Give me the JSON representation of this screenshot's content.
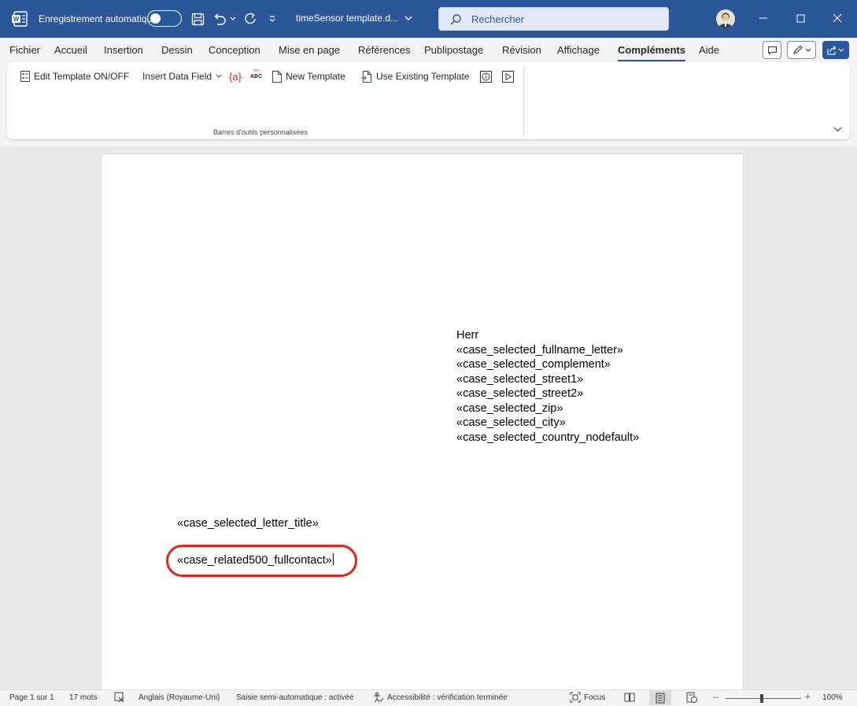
{
  "titlebar": {
    "autosave_label": "Enregistrement automatique",
    "filename": "timeSensor template.d...",
    "search_label": "Rechercher",
    "brand_color": "#2b579a"
  },
  "menu": {
    "items": [
      "Fichier",
      "Accueil",
      "Insertion",
      "Dessin",
      "Conception",
      "Mise en page",
      "Références",
      "Publipostage",
      "Révision",
      "Affichage",
      "Compléments",
      "Aide"
    ],
    "active": "Compléments"
  },
  "ribbon": {
    "edit_template": "Edit Template ON/OFF",
    "insert_data_field": "Insert Data Field",
    "abc_top": "«» ",
    "abc_bottom": "ABC",
    "braces": "{a}",
    "new_template": "New Template",
    "use_existing": "Use Existing Template",
    "group_label": "Barres d'outils personnalisées"
  },
  "document": {
    "address_lines": [
      "Herr",
      "«case_selected_fullname_letter»",
      "«case_selected_complement»",
      "«case_selected_street1»",
      "«case_selected_street2»",
      "«case_selected_zip»",
      "«case_selected_city»",
      "«case_selected_country_nodefault»"
    ],
    "letter_title": "«case_selected_letter_title»",
    "full_contact": "«case_related500_fullcontact»",
    "highlight_color": "#e0261c"
  },
  "status": {
    "page": "Page 1 sur 1",
    "words": "17 mots",
    "language": "Anglais (Royaume-Uni)",
    "autocomplete": "Saisie semi-automatique : activée",
    "accessibility": "Accessibilité : vérification terminée",
    "focus": "Focus",
    "zoom_minus": "–",
    "zoom_plus": "+",
    "zoom": "100%"
  }
}
